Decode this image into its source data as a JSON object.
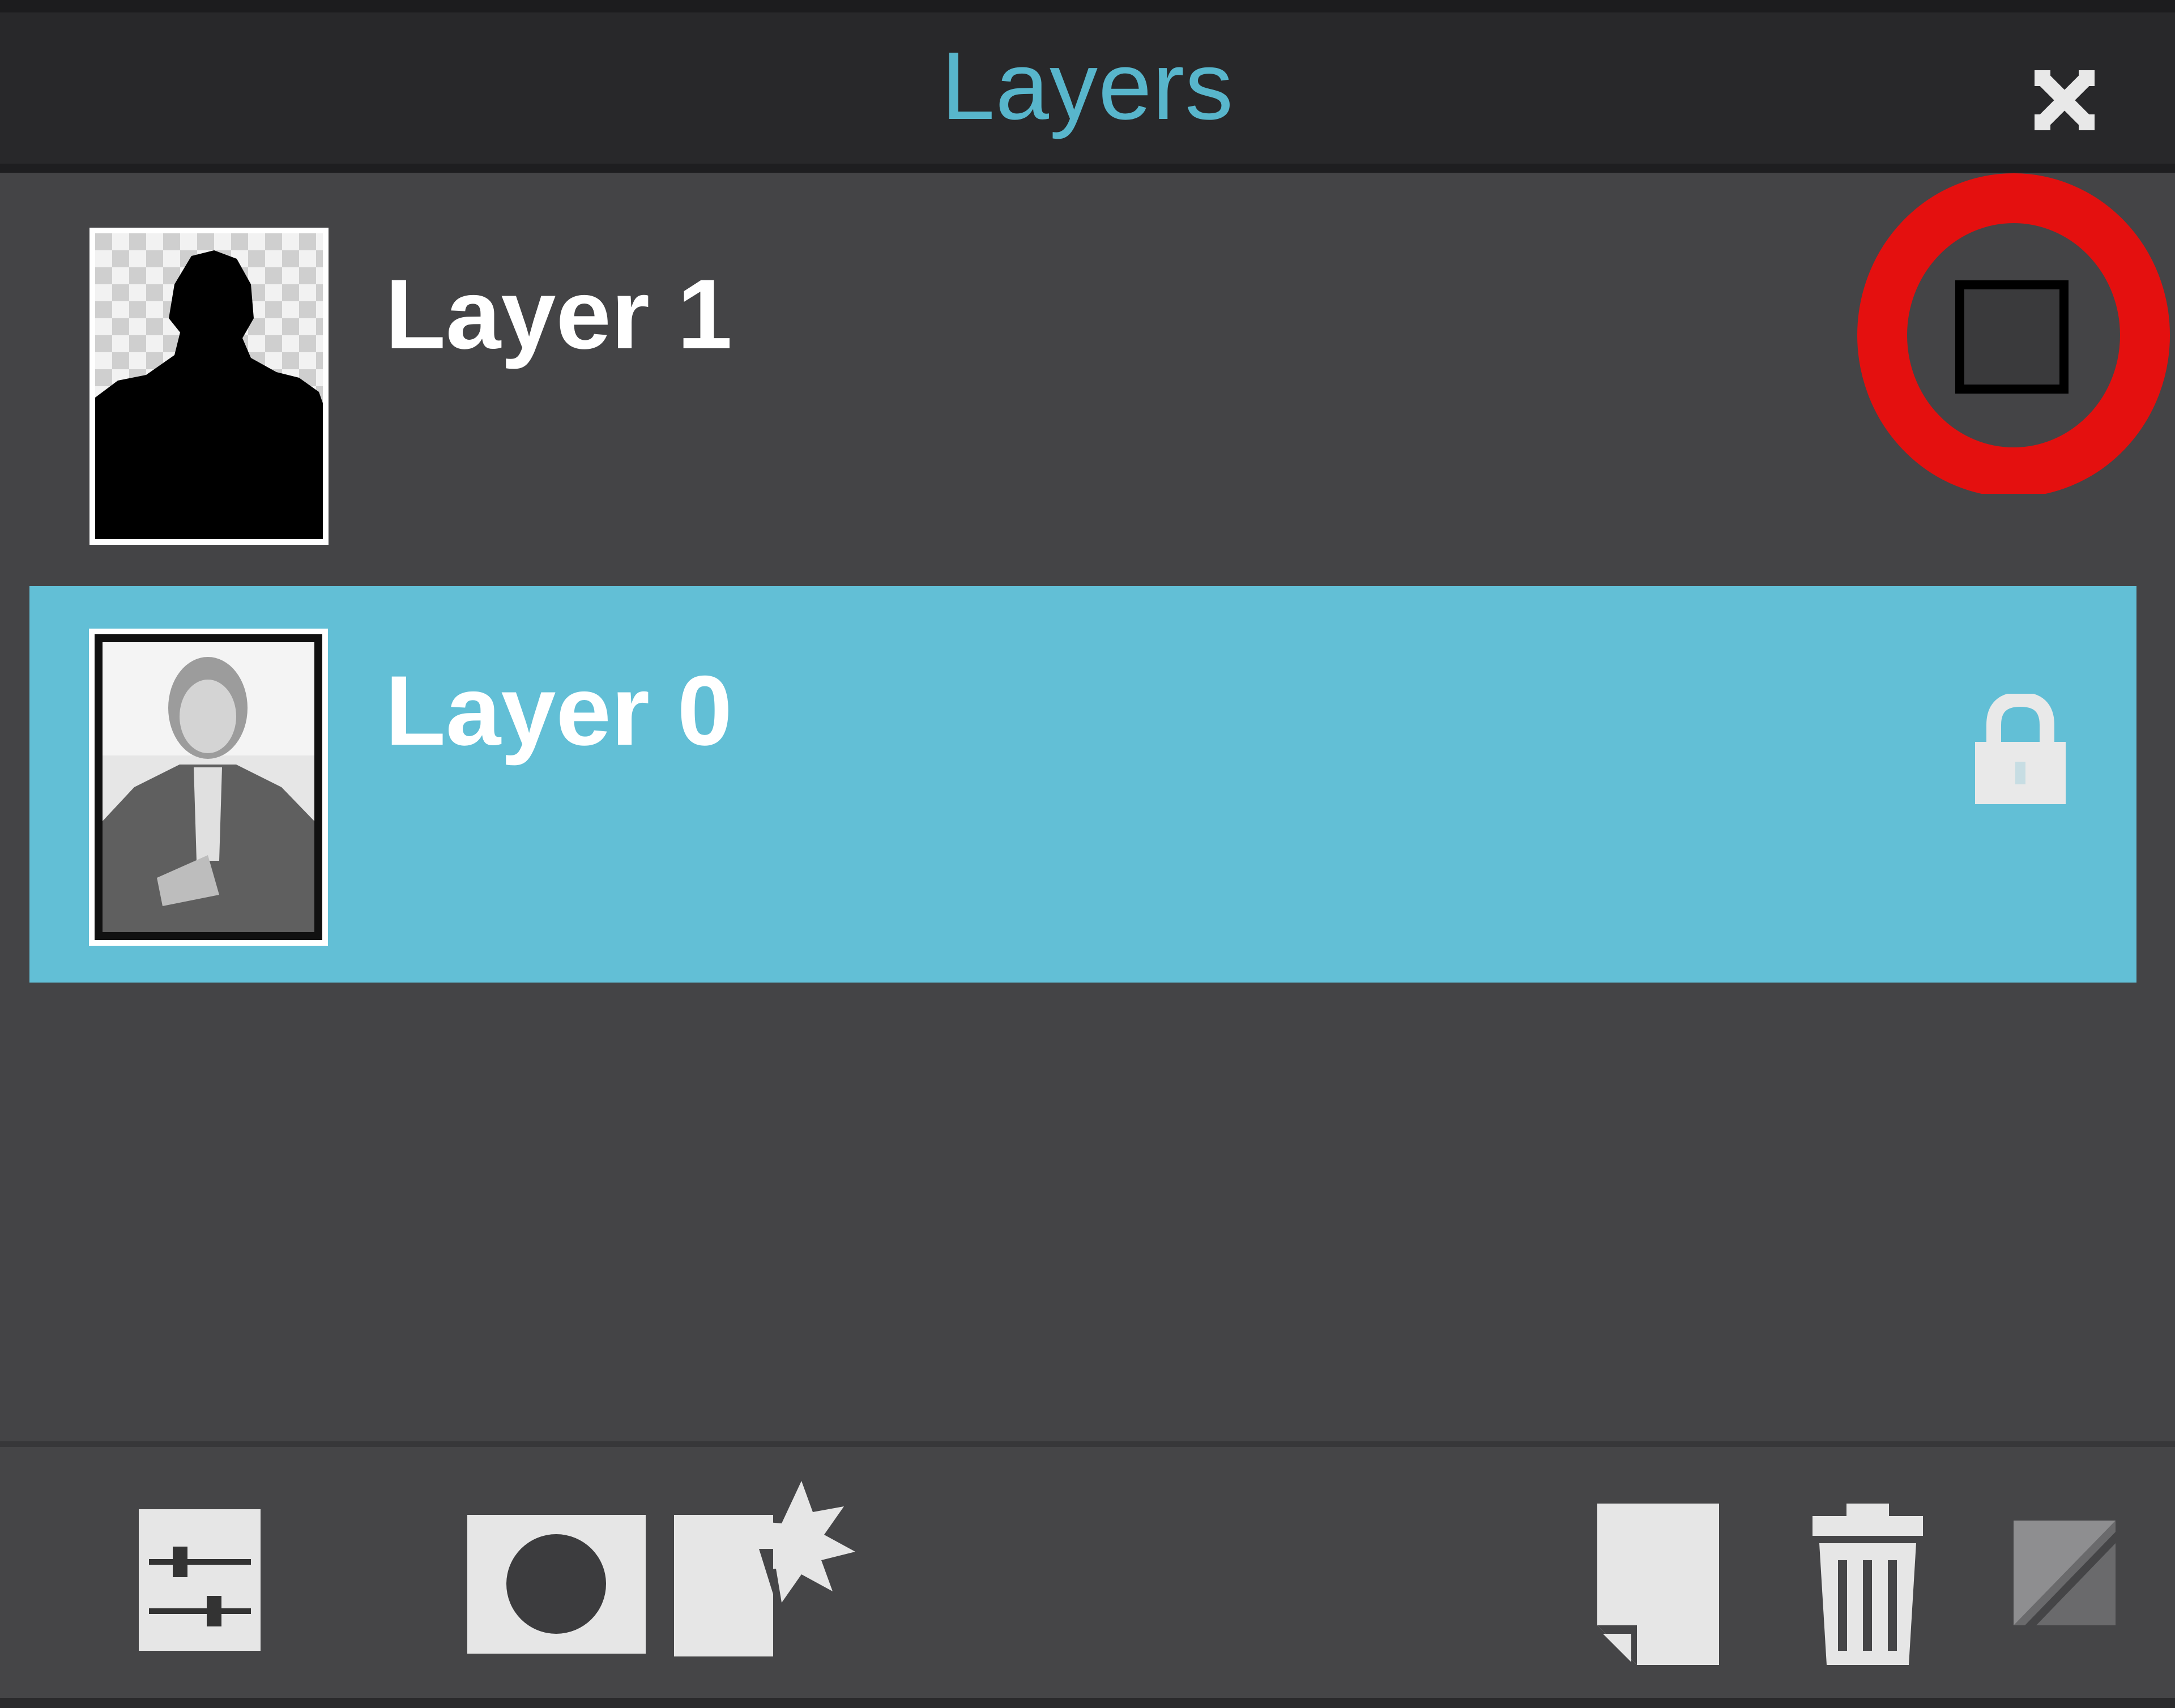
{
  "panel": {
    "title": "Layers"
  },
  "layers": [
    {
      "name": "Layer 1",
      "selected": false,
      "status_icon": "visibility-toggle-empty",
      "annotated": true
    },
    {
      "name": "Layer 0",
      "selected": true,
      "status_icon": "lock-icon"
    }
  ],
  "toolbar": {
    "icons": [
      "adjustments-icon",
      "layer-mask-icon",
      "layer-effects-icon",
      "new-layer-icon",
      "trash-icon",
      "fill-adjustment-icon"
    ]
  },
  "colors": {
    "title_text": "#58b6cc",
    "selected_row": "#62bfd6",
    "panel_bg": "#444446",
    "titlebar_bg": "#28282a",
    "annotation": "#e4100f"
  }
}
